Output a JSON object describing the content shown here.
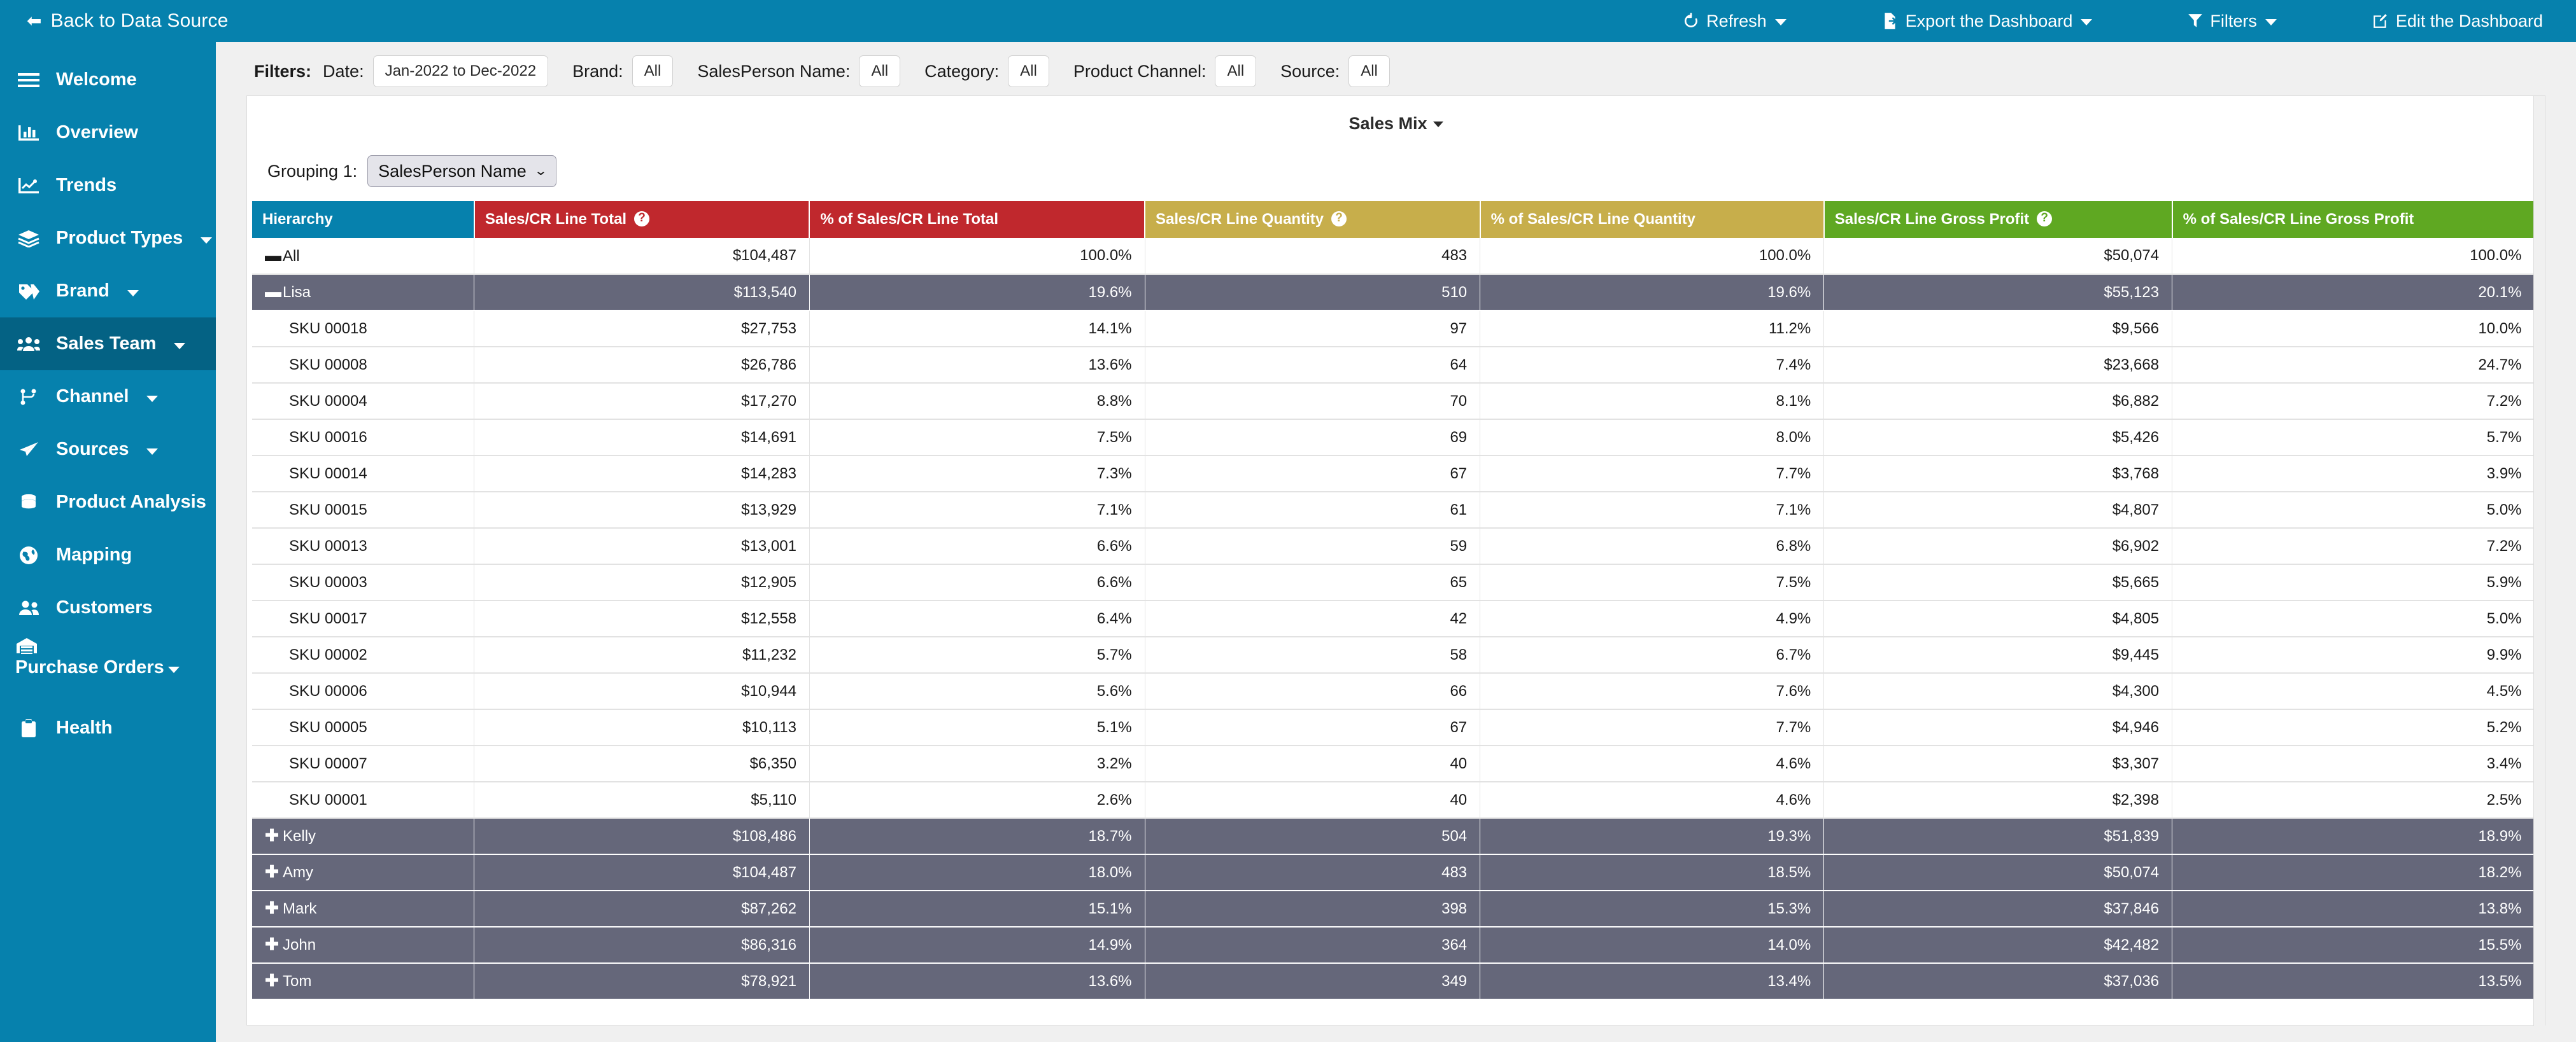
{
  "topbar": {
    "back_label": "Back to Data Source",
    "actions": [
      {
        "label": "Refresh",
        "icon": "refresh-icon",
        "caret": true
      },
      {
        "label": "Export the Dashboard",
        "icon": "export-icon",
        "caret": true
      },
      {
        "label": "Filters",
        "icon": "funnel-icon",
        "caret": true
      },
      {
        "label": "Edit the Dashboard",
        "icon": "edit-icon",
        "caret": false
      }
    ]
  },
  "sidebar": {
    "items": [
      {
        "label": "Welcome",
        "icon": "hamburger-icon",
        "caret": false,
        "active": false,
        "wrap": false
      },
      {
        "label": "Overview",
        "icon": "bar-chart-icon",
        "caret": false,
        "active": false,
        "wrap": false
      },
      {
        "label": "Trends",
        "icon": "line-chart-icon",
        "caret": false,
        "active": false,
        "wrap": false
      },
      {
        "label": "Product Types",
        "icon": "layers-icon",
        "caret": true,
        "active": false,
        "wrap": false
      },
      {
        "label": "Brand",
        "icon": "tag-icon",
        "caret": true,
        "active": false,
        "wrap": false
      },
      {
        "label": "Sales Team",
        "icon": "users-group-icon",
        "caret": true,
        "active": true,
        "wrap": false
      },
      {
        "label": "Channel",
        "icon": "sitemap-icon",
        "caret": true,
        "active": false,
        "wrap": false
      },
      {
        "label": "Sources",
        "icon": "paper-plane-icon",
        "caret": true,
        "active": false,
        "wrap": false
      },
      {
        "label": "Product Analysis",
        "icon": "database-icon",
        "caret": false,
        "active": false,
        "wrap": false
      },
      {
        "label": "Mapping",
        "icon": "globe-icon",
        "caret": false,
        "active": false,
        "wrap": false
      },
      {
        "label": "Customers",
        "icon": "users-icon",
        "caret": false,
        "active": false,
        "wrap": false
      },
      {
        "label": "Purchase Orders",
        "icon": "warehouse-icon",
        "caret": true,
        "active": false,
        "wrap": true
      },
      {
        "label": "Health",
        "icon": "clipboard-icon",
        "caret": false,
        "active": false,
        "wrap": false
      }
    ]
  },
  "filters": {
    "title": "Filters:",
    "fields": [
      {
        "label": "Date:",
        "value": "Jan-2022 to Dec-2022",
        "kind": "date"
      },
      {
        "label": "Brand:",
        "value": "All",
        "kind": "all"
      },
      {
        "label": "SalesPerson Name:",
        "value": "All",
        "kind": "all"
      },
      {
        "label": "Category:",
        "value": "All",
        "kind": "all"
      },
      {
        "label": "Product Channel:",
        "value": "All",
        "kind": "all"
      },
      {
        "label": "Source:",
        "value": "All",
        "kind": "all"
      }
    ]
  },
  "panel": {
    "title": "Sales Mix",
    "grouping_label": "Grouping 1:",
    "grouping_value": "SalesPerson Name"
  },
  "colors": {
    "brand_blue": "#0681AD",
    "sidebar_active": "#046284",
    "header_red": "#C0282D",
    "header_gold": "#C7AE4B",
    "header_green": "#5FA822",
    "row_dark": "#65677A"
  },
  "chart_data": {
    "type": "table",
    "title": "Sales Mix",
    "columns": [
      "Hierarchy",
      "Sales/CR Line Total",
      "% of Sales/CR Line Total",
      "Sales/CR Line Quantity",
      "% of Sales/CR Line Quantity",
      "Sales/CR Line Gross Profit",
      "% of Sales/CR Line Gross Profit"
    ],
    "column_colors": [
      "#0681AD",
      "#C0282D",
      "#C0282D",
      "#C7AE4B",
      "#C7AE4B",
      "#5FA822",
      "#5FA822"
    ],
    "column_info_icons": [
      false,
      true,
      false,
      true,
      false,
      true,
      false
    ],
    "rows": [
      {
        "label": "All",
        "toggle": "minus",
        "level": 0,
        "highlight": false,
        "cells": [
          "$104,487",
          "100.0%",
          "483",
          "100.0%",
          "$50,074",
          "100.0%"
        ]
      },
      {
        "label": "Lisa",
        "toggle": "minus",
        "level": 1,
        "highlight": true,
        "cells": [
          "$113,540",
          "19.6%",
          "510",
          "19.6%",
          "$55,123",
          "20.1%"
        ]
      },
      {
        "label": "SKU 00018",
        "toggle": "",
        "level": 2,
        "highlight": false,
        "cells": [
          "$27,753",
          "14.1%",
          "97",
          "11.2%",
          "$9,566",
          "10.0%"
        ]
      },
      {
        "label": "SKU 00008",
        "toggle": "",
        "level": 2,
        "highlight": false,
        "cells": [
          "$26,786",
          "13.6%",
          "64",
          "7.4%",
          "$23,668",
          "24.7%"
        ]
      },
      {
        "label": "SKU 00004",
        "toggle": "",
        "level": 2,
        "highlight": false,
        "cells": [
          "$17,270",
          "8.8%",
          "70",
          "8.1%",
          "$6,882",
          "7.2%"
        ]
      },
      {
        "label": "SKU 00016",
        "toggle": "",
        "level": 2,
        "highlight": false,
        "cells": [
          "$14,691",
          "7.5%",
          "69",
          "8.0%",
          "$5,426",
          "5.7%"
        ]
      },
      {
        "label": "SKU 00014",
        "toggle": "",
        "level": 2,
        "highlight": false,
        "cells": [
          "$14,283",
          "7.3%",
          "67",
          "7.7%",
          "$3,768",
          "3.9%"
        ]
      },
      {
        "label": "SKU 00015",
        "toggle": "",
        "level": 2,
        "highlight": false,
        "cells": [
          "$13,929",
          "7.1%",
          "61",
          "7.1%",
          "$4,807",
          "5.0%"
        ]
      },
      {
        "label": "SKU 00013",
        "toggle": "",
        "level": 2,
        "highlight": false,
        "cells": [
          "$13,001",
          "6.6%",
          "59",
          "6.8%",
          "$6,902",
          "7.2%"
        ]
      },
      {
        "label": "SKU 00003",
        "toggle": "",
        "level": 2,
        "highlight": false,
        "cells": [
          "$12,905",
          "6.6%",
          "65",
          "7.5%",
          "$5,665",
          "5.9%"
        ]
      },
      {
        "label": "SKU 00017",
        "toggle": "",
        "level": 2,
        "highlight": false,
        "cells": [
          "$12,558",
          "6.4%",
          "42",
          "4.9%",
          "$4,805",
          "5.0%"
        ]
      },
      {
        "label": "SKU 00002",
        "toggle": "",
        "level": 2,
        "highlight": false,
        "cells": [
          "$11,232",
          "5.7%",
          "58",
          "6.7%",
          "$9,445",
          "9.9%"
        ]
      },
      {
        "label": "SKU 00006",
        "toggle": "",
        "level": 2,
        "highlight": false,
        "cells": [
          "$10,944",
          "5.6%",
          "66",
          "7.6%",
          "$4,300",
          "4.5%"
        ]
      },
      {
        "label": "SKU 00005",
        "toggle": "",
        "level": 2,
        "highlight": false,
        "cells": [
          "$10,113",
          "5.1%",
          "67",
          "7.7%",
          "$4,946",
          "5.2%"
        ]
      },
      {
        "label": "SKU 00007",
        "toggle": "",
        "level": 2,
        "highlight": false,
        "cells": [
          "$6,350",
          "3.2%",
          "40",
          "4.6%",
          "$3,307",
          "3.4%"
        ]
      },
      {
        "label": "SKU 00001",
        "toggle": "",
        "level": 2,
        "highlight": false,
        "cells": [
          "$5,110",
          "2.6%",
          "40",
          "4.6%",
          "$2,398",
          "2.5%"
        ]
      },
      {
        "label": "Kelly",
        "toggle": "plus",
        "level": 1,
        "highlight": true,
        "cells": [
          "$108,486",
          "18.7%",
          "504",
          "19.3%",
          "$51,839",
          "18.9%"
        ]
      },
      {
        "label": "Amy",
        "toggle": "plus",
        "level": 1,
        "highlight": true,
        "cells": [
          "$104,487",
          "18.0%",
          "483",
          "18.5%",
          "$50,074",
          "18.2%"
        ]
      },
      {
        "label": "Mark",
        "toggle": "plus",
        "level": 1,
        "highlight": true,
        "cells": [
          "$87,262",
          "15.1%",
          "398",
          "15.3%",
          "$37,846",
          "13.8%"
        ]
      },
      {
        "label": "John",
        "toggle": "plus",
        "level": 1,
        "highlight": true,
        "cells": [
          "$86,316",
          "14.9%",
          "364",
          "14.0%",
          "$42,482",
          "15.5%"
        ]
      },
      {
        "label": "Tom",
        "toggle": "plus",
        "level": 1,
        "highlight": true,
        "cells": [
          "$78,921",
          "13.6%",
          "349",
          "13.4%",
          "$37,036",
          "13.5%"
        ]
      }
    ]
  }
}
